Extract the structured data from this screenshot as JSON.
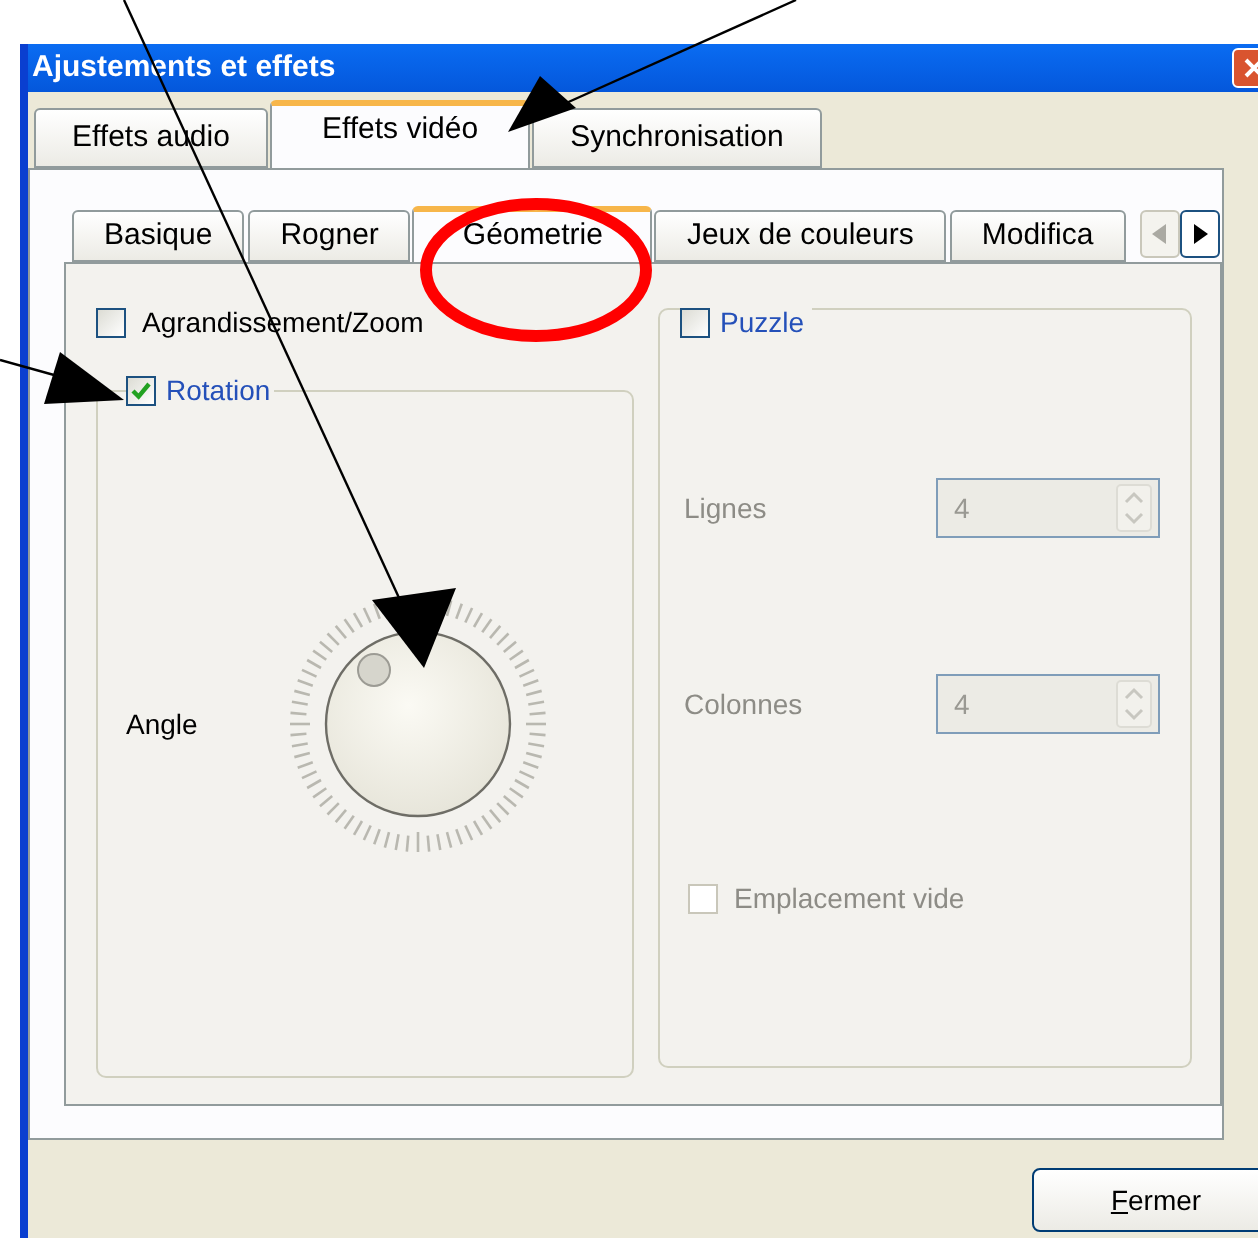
{
  "window": {
    "title": "Ajustements et effets"
  },
  "tabs": [
    {
      "label": "Effets audio",
      "selected": false
    },
    {
      "label": "Effets vidéo",
      "selected": true
    },
    {
      "label": "Synchronisation",
      "selected": false
    }
  ],
  "subtabs": [
    {
      "label": "Basique",
      "selected": false
    },
    {
      "label": "Rogner",
      "selected": false
    },
    {
      "label": "Géometrie",
      "selected": true
    },
    {
      "label": "Jeux de couleurs",
      "selected": false
    },
    {
      "label": "Modifica",
      "selected": false
    }
  ],
  "zoom": {
    "label": "Agrandissement/Zoom",
    "checked": false
  },
  "rotation": {
    "label": "Rotation",
    "checked": true,
    "angle_label": "Angle"
  },
  "puzzle": {
    "label": "Puzzle",
    "checked": false,
    "fields": [
      {
        "label": "Lignes",
        "value": "4",
        "disabled": true
      },
      {
        "label": "Colonnes",
        "value": "4",
        "disabled": true
      }
    ],
    "empty_slot": {
      "label": "Emplacement vide",
      "checked": false,
      "disabled": true
    }
  },
  "buttons": [
    {
      "label": "Fermer"
    }
  ]
}
